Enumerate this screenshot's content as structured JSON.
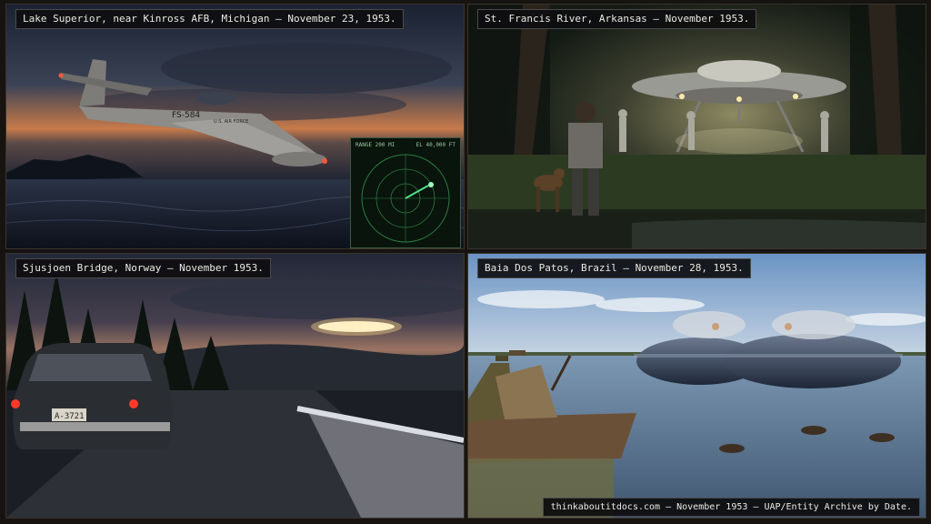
{
  "panels": [
    {
      "caption": "Lake Superior, near Kinross AFB, Michigan — November 23, 1953."
    },
    {
      "caption": "St. Francis River, Arkansas — November 1953."
    },
    {
      "caption": "Sjusjoen Bridge, Norway — November 1953."
    },
    {
      "caption": "Baia Dos Patos, Brazil — November 28, 1953."
    }
  ],
  "radar": {
    "range_label": "RANGE 200 MI",
    "elevation_label": "EL 40,000 FT"
  },
  "jet": {
    "tail_code": "FS-584",
    "marking": "U.S. AIR FORCE"
  },
  "car": {
    "plate": "A-3721"
  },
  "footer": "thinkaboutitdocs.com — November 1953 — UAP/Entity Archive by Date.",
  "colors": {
    "caption_bg": "#0e0e10",
    "caption_text": "#eceae4",
    "radar_green": "#4fe08a",
    "frame": "#161310"
  }
}
